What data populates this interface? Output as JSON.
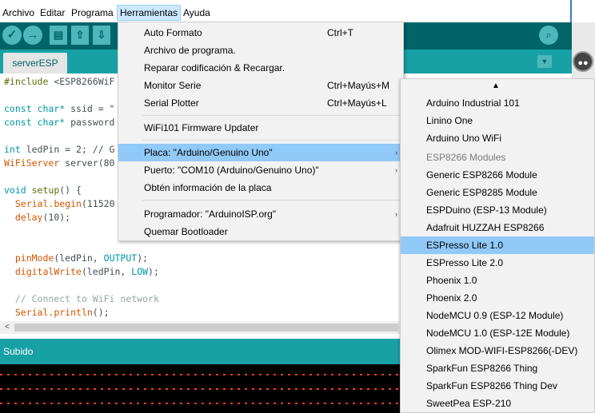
{
  "menubar": {
    "items": [
      "Archivo",
      "Editar",
      "Programa",
      "Herramientas",
      "Ayuda"
    ]
  },
  "toolbar": {
    "verify_icon": "check-icon",
    "upload_icon": "arrow-right-icon",
    "new_icon": "file-icon",
    "open_icon": "arrow-up-icon",
    "save_icon": "arrow-down-icon",
    "serial_icon": "magnifier-icon"
  },
  "tabs": {
    "active": "serverESP"
  },
  "code": {
    "line1_pp": "#include",
    "line1_rest": " <ESP8266WiF",
    "line3_type": "const char*",
    "line3_rest": " ssid = \"",
    "line4_type": "const char*",
    "line4_rest": " password",
    "line6_type": "int",
    "line6_rest": " ledPin = 2; // G",
    "line7_type": "WiFiServer",
    "line7_rest": " server(80",
    "line9_type": "void",
    "line9_fn": " setup",
    "line9_rest": "() {",
    "line10_obj": "Serial",
    "line10_fn": ".begin",
    "line10_rest": "(11520",
    "line11_fn": "delay",
    "line11_rest": "(10);",
    "line14_fn": "pinMode",
    "line14_mid": "(ledPin, ",
    "line14_const": "OUTPUT",
    "line14_end": ");",
    "line15_fn": "digitalWrite",
    "line15_mid": "(ledPin, ",
    "line15_const": "LOW",
    "line15_end": ");",
    "line17_comment": "// Connect to WiFi network",
    "line18_obj": "Serial",
    "line18_fn": ".println",
    "line18_rest": "();"
  },
  "status": {
    "text": "Subido"
  },
  "tools_menu": {
    "items": [
      {
        "label": "Auto Formato",
        "shortcut": "Ctrl+T"
      },
      {
        "label": "Archivo de programa.",
        "shortcut": ""
      },
      {
        "label": "Reparar codificación & Recargar.",
        "shortcut": ""
      },
      {
        "label": "Monitor Serie",
        "shortcut": "Ctrl+Mayús+M"
      },
      {
        "label": "Serial Plotter",
        "shortcut": "Ctrl+Mayús+L"
      },
      {
        "label": "WiFi101 Firmware Updater",
        "shortcut": ""
      },
      {
        "label": "Placa: \"Arduino/Genuino Uno\"",
        "shortcut": ""
      },
      {
        "label": "Puerto: \"COM10 (Arduino/Genuino Uno)\"",
        "shortcut": ""
      },
      {
        "label": "Obtén información de la placa",
        "shortcut": ""
      },
      {
        "label": "Programador: \"ArduinoISP.org\"",
        "shortcut": ""
      },
      {
        "label": "Quemar Bootloader",
        "shortcut": ""
      }
    ]
  },
  "board_menu": {
    "items": [
      "Arduino Industrial 101",
      "Linino One",
      "Arduino Uno WiFi",
      "ESP8266 Modules",
      "Generic ESP8266 Module",
      "Generic ESP8285 Module",
      "ESPDuino (ESP-13 Module)",
      "Adafruit HUZZAH ESP8266",
      "ESPresso Lite 1.0",
      "ESPresso Lite 2.0",
      "Phoenix 1.0",
      "Phoenix 2.0",
      "NodeMCU 0.9 (ESP-12 Module)",
      "NodeMCU 1.0 (ESP-12E Module)",
      "Olimex MOD-WIFI-ESP8266(-DEV)",
      "SparkFun ESP8266 Thing",
      "SparkFun ESP8266 Thing Dev",
      "SweetPea ESP-210"
    ],
    "selected": "ESPresso Lite 1.0"
  },
  "colors": {
    "toolbar": "#006468",
    "tabbar": "#17a1a5",
    "menu_highlight": "#91c9f7"
  }
}
